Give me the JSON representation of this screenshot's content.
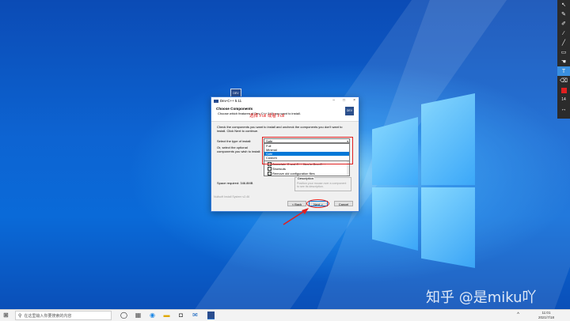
{
  "dialog": {
    "title": "Dev-C++ 5.11",
    "header_title": "Choose Components",
    "header_subtitle": "Choose which features of Dev-C++ 5.11 you want to install.",
    "logo_text": "DEV",
    "annotation": "选择 Full 或者 Full",
    "intro": "Check the components you want to install and uncheck the components you don't want to install. Click Next to continue.",
    "type_label": "Select the type of install:",
    "select_label": "Or, select the optional components you wish to install:",
    "install_type_value": "Safe",
    "install_types": [
      "Full",
      "Minimal",
      "Safe",
      "Custom"
    ],
    "selected_type": "Safe",
    "tree_items": [
      "Associate C and C++ files to Dev-C++",
      "Shortcuts",
      "Remove old configuration files"
    ],
    "description_title": "Description",
    "description_text": "Position your mouse over a component to see its description.",
    "space_required": "Space required: 346.8MB",
    "nsis": "Nullsoft Install System v2.46",
    "buttons": {
      "back": "< Back",
      "next": "Next >",
      "cancel": "Cancel"
    }
  },
  "desktop_icon_label": "DEV",
  "watermark": "知乎 @是miku吖",
  "toolbar": {
    "tools": [
      "cursor-icon",
      "pen-icon",
      "marker-icon",
      "brush-icon",
      "line-icon",
      "rect-icon",
      "pointer-icon",
      "text-icon",
      "eraser-icon",
      "color-icon",
      "size-icon",
      "undo-icon"
    ],
    "size_value": "14",
    "highlight_color": "#e02020"
  },
  "taskbar": {
    "search_placeholder": "在这里输入你要搜索的内容",
    "time": "11:01",
    "date": "2021/7/18"
  }
}
